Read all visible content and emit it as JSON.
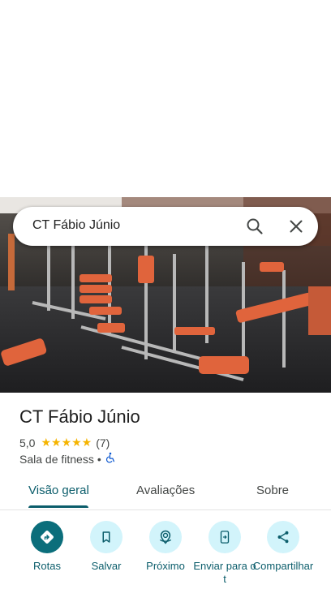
{
  "search": {
    "query": "CT Fábio Júnio"
  },
  "place": {
    "name": "CT Fábio Júnio",
    "rating": "5,0",
    "stars": "★★★★★",
    "review_count": "(7)",
    "category": "Sala de fitness",
    "separator": "•"
  },
  "tabs": [
    {
      "label": "Visão geral"
    },
    {
      "label": "Avaliações"
    },
    {
      "label": "Sobre"
    }
  ],
  "actions": [
    {
      "label": "Rotas",
      "icon": "directions-icon"
    },
    {
      "label": "Salvar",
      "icon": "bookmark-icon"
    },
    {
      "label": "Próximo",
      "icon": "nearby-icon"
    },
    {
      "label": "Enviar para o t",
      "icon": "send-to-phone-icon"
    },
    {
      "label": "Compartilhar",
      "icon": "share-icon"
    }
  ],
  "colors": {
    "accent": "#0b5d6b",
    "chip": "#d2f4fb",
    "star": "#f5b400"
  }
}
